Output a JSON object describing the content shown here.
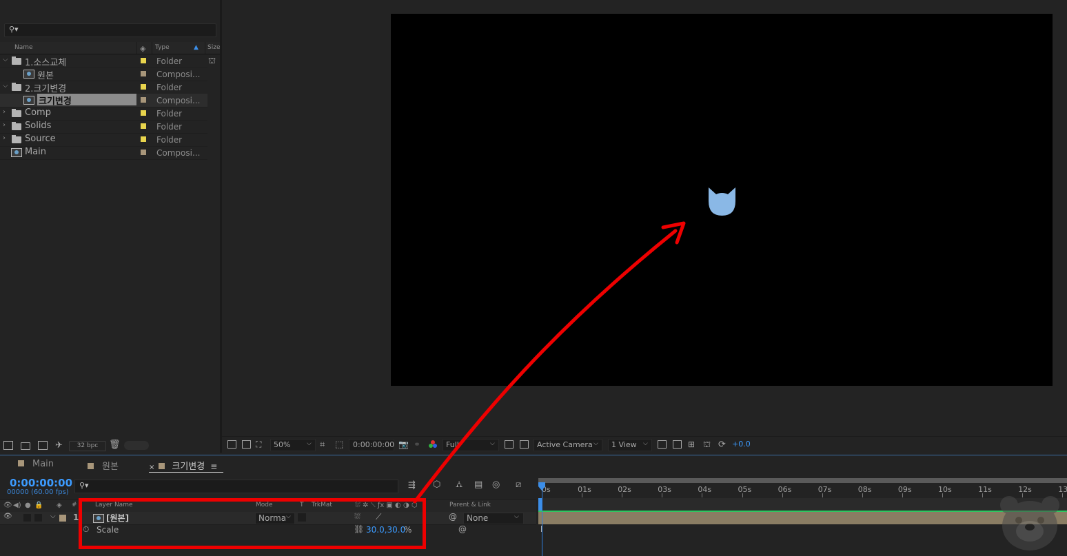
{
  "project": {
    "search_placeholder": "",
    "columns": {
      "name": "Name",
      "type": "Type",
      "size": "Size"
    },
    "rows": [
      {
        "name": "1.소스교체",
        "type": "Folder",
        "kind": "folder",
        "expanded": true,
        "indent": 0,
        "tag": "#e8d44d"
      },
      {
        "name": "원본",
        "type": "Composi...",
        "kind": "comp",
        "indent": 1,
        "tag": "#a8967a"
      },
      {
        "name": "2.크기변경",
        "type": "Folder",
        "kind": "folder",
        "expanded": true,
        "indent": 0,
        "tag": "#e8d44d"
      },
      {
        "name": "크기변경",
        "type": "Composi...",
        "kind": "comp",
        "indent": 1,
        "selected": true,
        "tag": "#a8967a"
      },
      {
        "name": "Comp",
        "type": "Folder",
        "kind": "folder",
        "expanded": false,
        "indent": 0,
        "tag": "#e8d44d"
      },
      {
        "name": "Solids",
        "type": "Folder",
        "kind": "folder",
        "expanded": false,
        "indent": 0,
        "tag": "#e8d44d"
      },
      {
        "name": "Source",
        "type": "Folder",
        "kind": "folder",
        "expanded": false,
        "indent": 0,
        "tag": "#e8d44d"
      },
      {
        "name": "Main",
        "type": "Composi...",
        "kind": "comp",
        "indent": 0,
        "tag": "#a8967a"
      }
    ],
    "footer": {
      "bpc": "32 bpc"
    }
  },
  "viewer": {
    "zoom": "50%",
    "timecode": "0:00:00:00",
    "resolution": "Full",
    "camera": "Active Camera",
    "view": "1 View",
    "exposure": "+0.0",
    "shape_color": "#8ab8e6"
  },
  "timeline": {
    "tabs": [
      {
        "label": "Main",
        "color": "#a8967a"
      },
      {
        "label": "원본",
        "color": "#a8967a"
      },
      {
        "label": "크기변경",
        "color": "#a8967a",
        "active": true
      }
    ],
    "timecode": "0:00:00:00",
    "frames": "00000 (60.00 fps)",
    "headers": {
      "num": "#",
      "layer_name": "Layer Name",
      "mode": "Mode",
      "t": "T",
      "trkmat": "TrkMat",
      "parent": "Parent & Link"
    },
    "layer": {
      "index": "1",
      "name": "[원본]",
      "mode": "Norma",
      "parent": "None"
    },
    "property": {
      "name": "Scale",
      "value": "30.0,30.0",
      "unit": "%"
    },
    "ruler": [
      "0s",
      "01s",
      "02s",
      "03s",
      "04s",
      "05s",
      "06s",
      "07s",
      "08s",
      "09s",
      "10s",
      "11s",
      "12s",
      "13"
    ],
    "track_color": "#8a7d63",
    "accent": "#3c9bff"
  },
  "annotation": {
    "color": "#ee0000"
  }
}
